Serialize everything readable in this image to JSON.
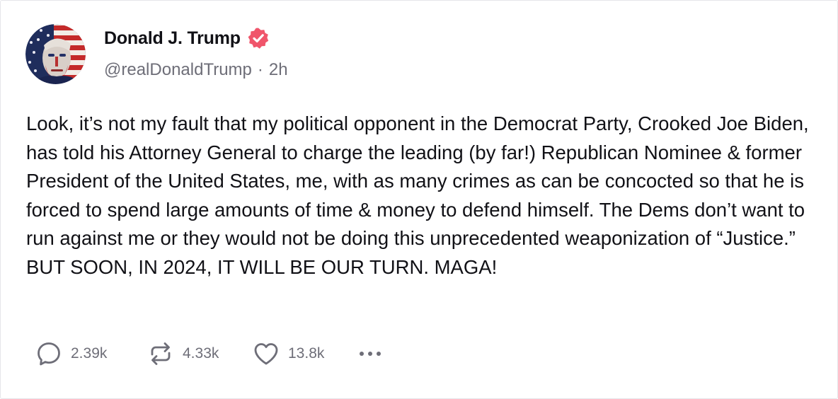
{
  "post": {
    "author": {
      "display_name": "Donald J. Trump",
      "handle": "@realDonaldTrump",
      "verified": true,
      "verified_color": "#f0556b",
      "avatar_icon": "flag-portrait-avatar"
    },
    "separator": "·",
    "time": "2h",
    "text": "Look, it’s not my fault that my political opponent in the Democrat Party, Crooked Joe Biden, has told his Attorney General to charge the leading (by far!) Republican Nominee & former President of the United States, me, with as many crimes as can be concocted so that he is forced to spend large amounts of time & money to defend himself. The Dems don’t want to run against me or they would not be doing this unprecedented weaponization of “Justice.” BUT SOON, IN 2024, IT WILL BE OUR TURN. MAGA!",
    "actions": {
      "reply": {
        "icon": "reply-bubble-icon",
        "count": "2.39k"
      },
      "repost": {
        "icon": "repost-arrows-icon",
        "count": "4.33k"
      },
      "like": {
        "icon": "heart-icon",
        "count": "13.8k"
      },
      "more": {
        "icon": "more-dots-icon"
      }
    },
    "colors": {
      "text": "#111116",
      "muted": "#6e6e78",
      "border": "#e6e6ea"
    }
  }
}
